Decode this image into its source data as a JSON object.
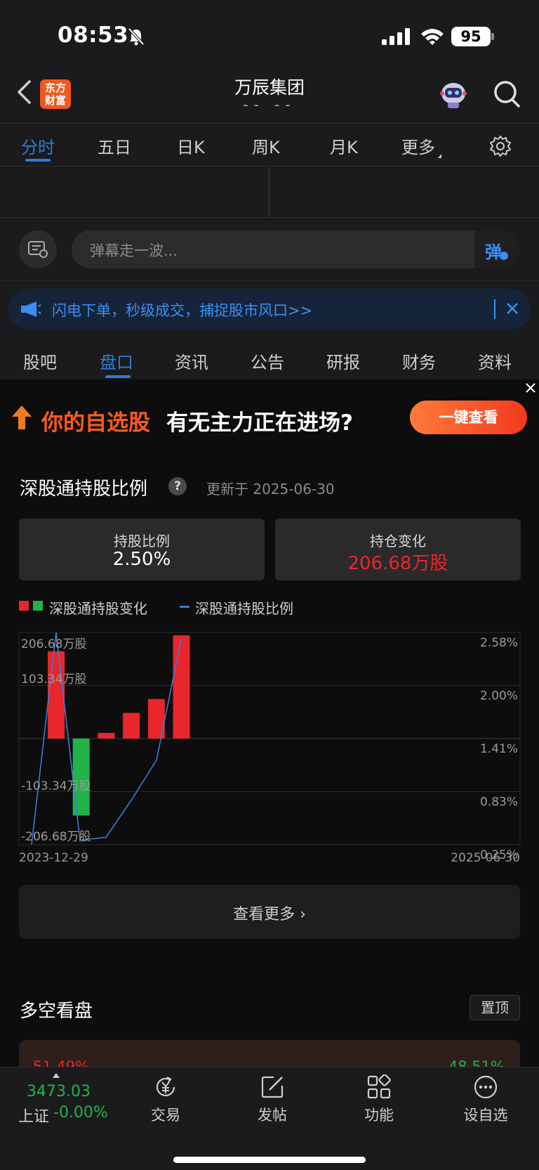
{
  "status_bar": {
    "time": "08:53",
    "battery": "95"
  },
  "header": {
    "logo_text": "东方财富",
    "title": "万辰集团",
    "subtitle": "-- --"
  },
  "period_tabs": [
    "分时",
    "五日",
    "日K",
    "周K",
    "月K",
    "更多"
  ],
  "danmaku": {
    "placeholder": "弹幕走一波...",
    "send_label": "弹"
  },
  "notice": {
    "text": "闪电下单，秒级成交，捕捉股市风口>>"
  },
  "section_tabs": [
    "股吧",
    "盘口",
    "资讯",
    "公告",
    "研报",
    "财务",
    "资料"
  ],
  "promo": {
    "highlight": "你的自选股",
    "text": "有无主力正在进场?",
    "button": "一键查看"
  },
  "holdings": {
    "title": "深股通持股比例",
    "help": "?",
    "updated": "更新于 2025-06-30",
    "ratio_label": "持股比例",
    "ratio_value": "2.50%",
    "change_label": "持仓变化",
    "change_value": "206.68万股",
    "legend_change": "深股通持股变化",
    "legend_ratio": "深股通持股比例",
    "more_label": "查看更多"
  },
  "colors": {
    "up": "#e8262b",
    "down": "#1fb34a",
    "accent": "#2f7bd8",
    "promo": "#ff5a1f"
  },
  "chart_data": {
    "type": "bar",
    "x_start_label": "2023-12-29",
    "x_end_label": "2025-06-30",
    "left_ticks": [
      "206.68万股",
      "103.34万股",
      "-103.34万股",
      "-206.68万股"
    ],
    "right_ticks": [
      "2.58%",
      "2.00%",
      "1.41%",
      "0.83%",
      "0.25%"
    ],
    "series": [
      {
        "name": "深股通持股变化",
        "type": "bar",
        "unit": "万股",
        "values": [
          170,
          -150,
          11,
          50,
          77,
          201
        ]
      },
      {
        "name": "深股通持股比例",
        "type": "line",
        "unit": "%",
        "values": [
          0.25,
          2.58,
          0.3,
          0.33,
          0.76,
          1.18,
          2.5
        ]
      }
    ],
    "left_range": [
      -206.68,
      206.68
    ],
    "right_range": [
      0.25,
      2.58
    ],
    "grid": true
  },
  "duokong": {
    "title": "多空看盘",
    "pin": "置顶",
    "long_pct": "51.49%",
    "short_pct": "48.51%"
  },
  "bottom_bar": {
    "index_value": "3473.03",
    "index_name": "上证",
    "index_change": "-0.00%",
    "items": [
      "交易",
      "发帖",
      "功能",
      "设自选"
    ]
  }
}
